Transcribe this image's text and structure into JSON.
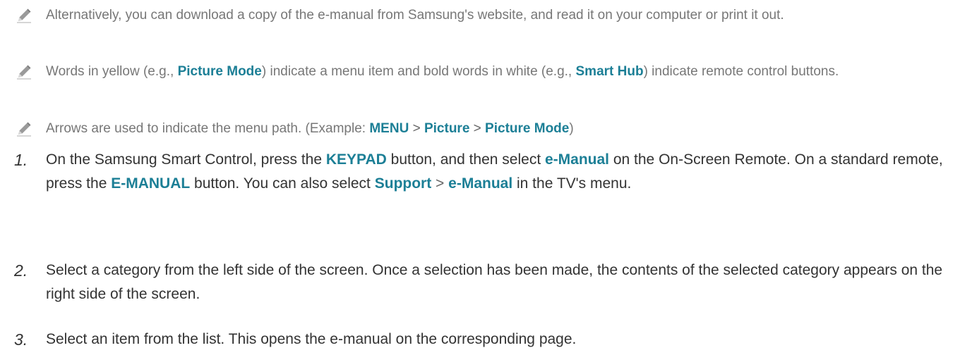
{
  "notes": [
    {
      "icon": "pencil-icon",
      "parts": [
        {
          "t": "Alternatively, you can download a copy of the e-manual from Samsung's website, and read it on your computer or print it out."
        }
      ]
    },
    {
      "icon": "pencil-icon",
      "parts": [
        {
          "t": "Words in yellow (e.g., "
        },
        {
          "t": "Picture Mode",
          "hl": true
        },
        {
          "t": ") indicate a menu item and bold words in white (e.g., "
        },
        {
          "t": "Smart Hub",
          "hl": true
        },
        {
          "t": ") indicate remote control buttons."
        }
      ]
    },
    {
      "icon": "pencil-icon",
      "parts": [
        {
          "t": "Arrows are used to indicate the menu path. (Example: "
        },
        {
          "t": "MENU",
          "hl": true
        },
        {
          "t": " > ",
          "sep": true
        },
        {
          "t": "Picture",
          "hl": true
        },
        {
          "t": " > ",
          "sep": true
        },
        {
          "t": "Picture Mode",
          "hl": true
        },
        {
          "t": ")"
        }
      ]
    }
  ],
  "steps": [
    {
      "number": "1.",
      "parts": [
        {
          "t": "On the Samsung Smart Control, press the "
        },
        {
          "t": "KEYPAD",
          "hl": true
        },
        {
          "t": " button, and then select "
        },
        {
          "t": "e-Manual",
          "hl": true
        },
        {
          "t": " on the On-Screen Remote. On a standard remote, press the "
        },
        {
          "t": "E-MANUAL",
          "hl": true
        },
        {
          "t": " button. You can also select "
        },
        {
          "t": "Support",
          "hl": true
        },
        {
          "t": " > ",
          "sep": true
        },
        {
          "t": "e-Manual",
          "hl": true
        },
        {
          "t": " in the TV's menu."
        }
      ]
    },
    {
      "number": "2.",
      "parts": [
        {
          "t": "Select a category from the left side of the screen. Once a selection has been made, the contents of the selected category appears on the right side of the screen."
        }
      ]
    },
    {
      "number": "3.",
      "parts": [
        {
          "t": "Select an item from the list. This opens the e-manual on the corresponding page."
        }
      ]
    }
  ]
}
